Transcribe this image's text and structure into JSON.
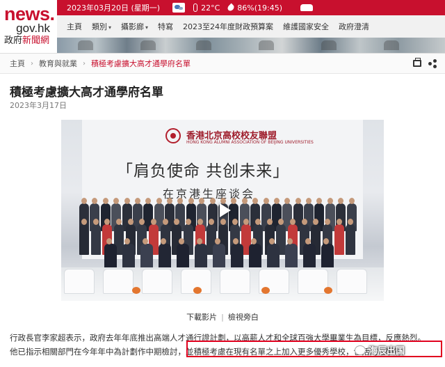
{
  "logo": {
    "line1": "news.",
    "line2": "gov.hk",
    "line3_a": "政府",
    "line3_b": "新聞網"
  },
  "topbar": {
    "date": "2023年03月20日 (星期一)",
    "temperature": "22°C",
    "humidity": "86%(19:45)"
  },
  "nav": {
    "items": [
      {
        "label": "主頁",
        "caret": ""
      },
      {
        "label": "類別",
        "caret": "▾"
      },
      {
        "label": "攝影廊",
        "caret": "▾"
      },
      {
        "label": "特寫",
        "caret": ""
      },
      {
        "label": "2023至24年度財政預算案",
        "caret": ""
      },
      {
        "label": "維護國家安全",
        "caret": ""
      },
      {
        "label": "政府澄清",
        "caret": ""
      }
    ]
  },
  "breadcrumb": {
    "home": "主頁",
    "sep": "›",
    "category": "教育與就業",
    "current": "積極考慮擴大高才通學府名單"
  },
  "article": {
    "title": "積極考慮擴大高才通學府名單",
    "date": "2023年3月17日",
    "media_banner_cn": "香港北京高校校友聯盟",
    "media_banner_en": "HONG KONG ALUMNI ASSOCIATION OF BEIJING UNIVERSITIES",
    "media_slogan": "「肩负使命 共创未来」",
    "media_subslogan": "在京港生座谈会",
    "caption_download": "下載影片",
    "caption_sep": "|",
    "caption_view": "檢視旁白",
    "para1": "行政長官李家超表示，政府去年年底推出高端人才通行證計劃，以高薪人才和全球百強大學畢業生為目標，反應熱烈。",
    "para2": "他已指示相關部門在今年年中為計劃作中期檢討，並積極考慮在現有名單之上加入更多優秀學校，包括內地學府。"
  },
  "watermark": {
    "text": "海辰出国"
  },
  "colors": {
    "brand_red": "#c8102e",
    "highlight_red": "#e1001e"
  },
  "icons": [
    "weather-cloud-icon",
    "thermometer-icon",
    "humidity-drop-icon",
    "traffic-car-icon",
    "print-icon",
    "share-icon",
    "play-icon",
    "wechat-icon"
  ]
}
